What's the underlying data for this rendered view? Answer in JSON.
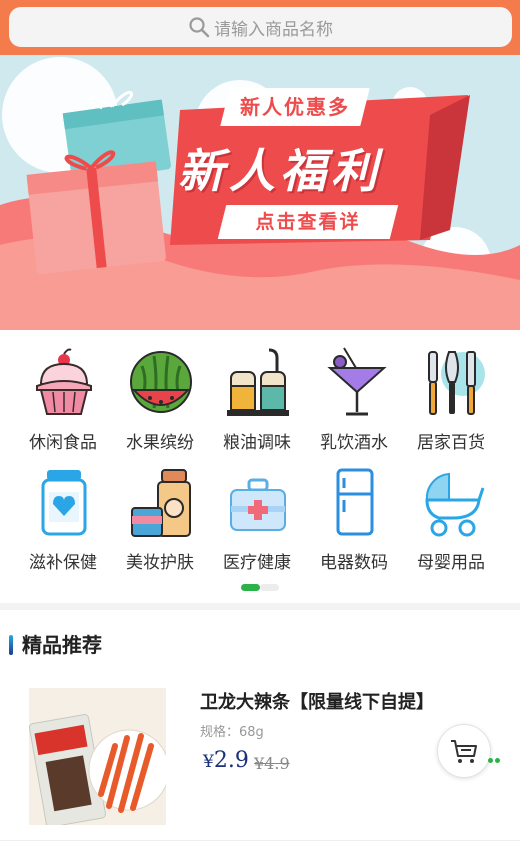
{
  "search": {
    "placeholder": "请输入商品名称"
  },
  "banner": {
    "tag": "新人优惠多",
    "headline": "新人福利",
    "cta": "点击查看详"
  },
  "categories": {
    "row1": [
      {
        "label": "休闲食品",
        "icon": "cupcake-icon"
      },
      {
        "label": "水果缤纷",
        "icon": "watermelon-icon"
      },
      {
        "label": "粮油调味",
        "icon": "condiment-icon"
      },
      {
        "label": "乳饮酒水",
        "icon": "cocktail-icon"
      },
      {
        "label": "居家百货",
        "icon": "kitchen-utensils-icon"
      }
    ],
    "row2": [
      {
        "label": "滋补保健",
        "icon": "health-jar-icon"
      },
      {
        "label": "美妆护肤",
        "icon": "cosmetics-icon"
      },
      {
        "label": "医疗健康",
        "icon": "medical-kit-icon"
      },
      {
        "label": "电器数码",
        "icon": "refrigerator-icon"
      },
      {
        "label": "母婴用品",
        "icon": "stroller-icon"
      }
    ]
  },
  "section": {
    "title": "精品推荐"
  },
  "product": {
    "name": "卫龙大辣条【限量线下自提】",
    "spec": "规格：68g",
    "currency": "¥",
    "price": "2.9",
    "old_price": "¥4.9"
  },
  "colors": {
    "topbar": "#f47c4c",
    "accent_green": "#2bb34a",
    "price": "#1b2f7a"
  }
}
